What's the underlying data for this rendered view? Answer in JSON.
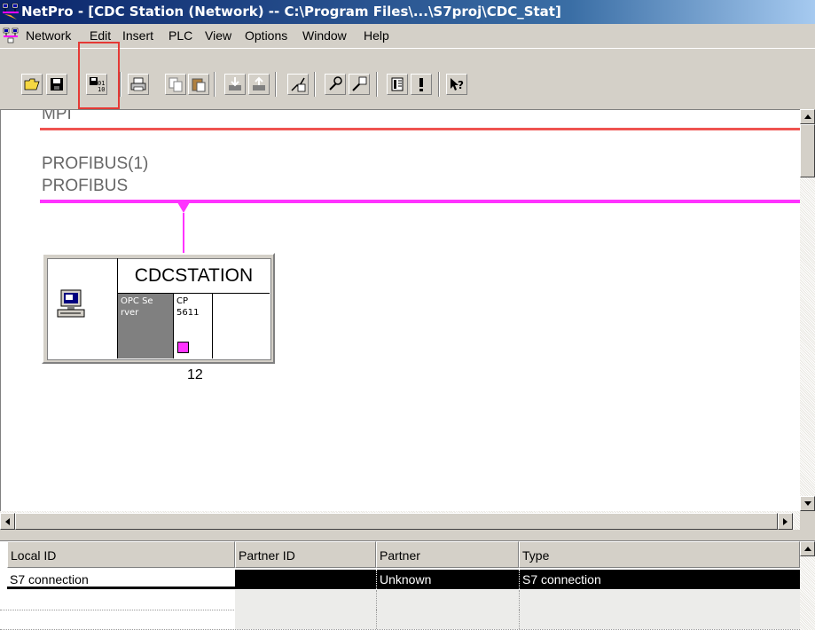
{
  "window": {
    "title": "NetPro - [CDC Station (Network) -- C:\\Program Files\\...\\S7proj\\CDC_Stat]",
    "app_icon": "netpro-icon"
  },
  "menubar": {
    "items": [
      "Network",
      "Edit",
      "Insert",
      "PLC",
      "View",
      "Options",
      "Window",
      "Help"
    ]
  },
  "toolbar": {
    "buttons": [
      {
        "name": "open-icon"
      },
      {
        "name": "save-icon"
      },
      {
        "name": "save-compile-icon",
        "highlighted": true
      },
      {
        "name": "print-icon"
      },
      {
        "name": "copy-icon"
      },
      {
        "name": "paste-icon"
      },
      {
        "name": "download-icon"
      },
      {
        "name": "upload-icon"
      },
      {
        "name": "online-station-icon"
      },
      {
        "name": "configure-network-icon"
      },
      {
        "name": "properties-icon"
      },
      {
        "name": "catalog-icon"
      },
      {
        "name": "diagnostics-icon"
      },
      {
        "name": "help-icon"
      }
    ],
    "highlight_color": "#e53935"
  },
  "network": {
    "mpi_label": "MPI",
    "mpi_color": "#ef5350",
    "profibus_label1": "PROFIBUS(1)",
    "profibus_label2": "PROFIBUS",
    "profibus_color": "#ff33ff",
    "station": {
      "name": "CDCSTATION",
      "slot1_line1": "OPC Se",
      "slot1_line2": "rver",
      "slot2_line1": "CP",
      "slot2_line2": "5611",
      "address": "12",
      "icon": "pc-station-icon"
    }
  },
  "connections_table": {
    "columns": [
      "Local ID",
      "Partner ID",
      "Partner",
      "Type"
    ],
    "rows": [
      {
        "local_id": "S7 connection",
        "partner_id": "",
        "partner": "Unknown",
        "type": "S7 connection"
      }
    ]
  }
}
